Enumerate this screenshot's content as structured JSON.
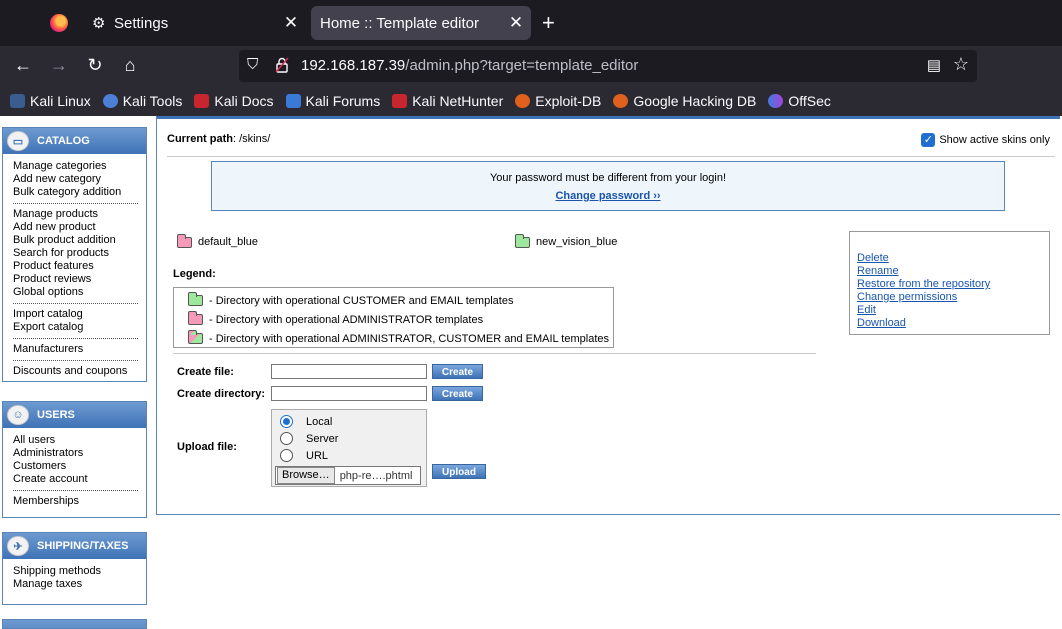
{
  "browser": {
    "tabs": [
      {
        "title": "Settings",
        "icon": "gear-icon",
        "active": false
      },
      {
        "title": "Home :: Template editor",
        "icon": "",
        "active": true
      }
    ],
    "url_host": "192.168.187.39",
    "url_path": "/admin.php?target=template_editor",
    "bookmarks": [
      "Kali Linux",
      "Kali Tools",
      "Kali Docs",
      "Kali Forums",
      "Kali NetHunter",
      "Exploit-DB",
      "Google Hacking DB",
      "OffSec"
    ]
  },
  "sidebar": {
    "catalog": {
      "title": "CATALOG",
      "groups": [
        [
          "Manage categories",
          "Add new category",
          "Bulk category addition"
        ],
        [
          "Manage products",
          "Add new product",
          "Bulk product addition",
          "Search for products",
          "Product features",
          "Product reviews",
          "Global options"
        ],
        [
          "Import catalog",
          "Export catalog"
        ],
        [
          "Manufacturers"
        ],
        [
          "Discounts and coupons"
        ]
      ]
    },
    "users": {
      "title": "USERS",
      "groups": [
        [
          "All users",
          "Administrators",
          "Customers",
          "Create account"
        ],
        [
          "Memberships"
        ]
      ]
    },
    "shipping": {
      "title": "SHIPPING/TAXES",
      "groups": [
        [
          "Shipping methods",
          "Manage taxes"
        ]
      ]
    }
  },
  "main": {
    "current_path_label": "Current path",
    "current_path_value": ": /skins/",
    "show_active_label": "Show active skins only",
    "notice_text": "Your password must be different from your login!",
    "notice_link": "Change password ››",
    "skins": [
      "default_blue",
      "new_vision_blue"
    ],
    "legend_title": "Legend:",
    "legend": [
      "- Directory with operational CUSTOMER and EMAIL templates",
      "- Directory with operational ADMINISTRATOR templates",
      "- Directory with operational ADMINISTRATOR, CUSTOMER and EMAIL templates"
    ],
    "actions": [
      "Delete",
      "Rename",
      "Restore from the repository",
      "Change permissions",
      "Edit",
      "Download"
    ],
    "create_file_label": "Create file:",
    "create_dir_label": "Create directory:",
    "upload_label": "Upload file:",
    "create_btn": "Create",
    "upload_btn": "Upload",
    "upload_options": [
      "Local",
      "Server",
      "URL"
    ],
    "browse_btn": "Browse…",
    "file_name": "php-re….phtml"
  },
  "colors": {
    "accent": "#3f73b7",
    "link": "#1a55ad",
    "folder_customer": "#9ee89e",
    "folder_admin": "#f59ab8",
    "folder_both": "#e8c88a"
  }
}
